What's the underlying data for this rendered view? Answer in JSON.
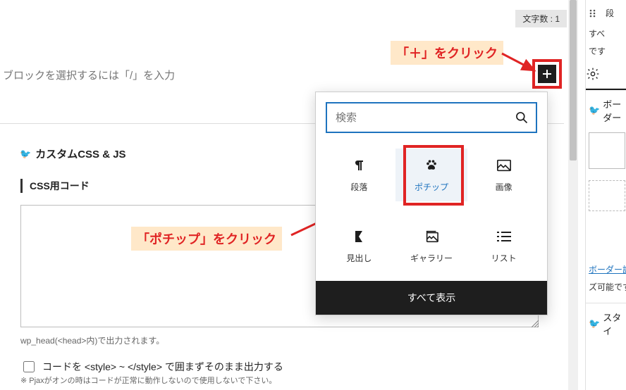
{
  "char_count": "文字数 : 1",
  "editor_placeholder": "ブロックを選択するには「/」を入力",
  "callout_plus": "「＋」をクリック",
  "callout_pochipp": "「ポチップ」をクリック",
  "section_title": "カスタムCSS & JS",
  "css_label": "CSS用コード",
  "css_value": "",
  "css_hint": "wp_head(<head>内)で出力されます。",
  "checkbox_label": "コードを <style> ~ </style> で囲まずそのまま出力する",
  "checkbox_note": "※ Pjaxがオンの時はコードが正常に動作しないので使用しないで下さい。",
  "inserter": {
    "search_placeholder": "検索",
    "items": [
      {
        "label": "段落"
      },
      {
        "label": "ポチップ"
      },
      {
        "label": "画像"
      },
      {
        "label": "見出し"
      },
      {
        "label": "ギャラリー"
      },
      {
        "label": "リスト"
      }
    ],
    "footer": "すべて表示"
  },
  "sidebar": {
    "frag1": "段",
    "frag2": "すべ",
    "frag3": "です",
    "border_label": "ボーダー",
    "border_link": "ボーダー設",
    "border_note": "ズ可能です",
    "style_label": "スタイ"
  }
}
